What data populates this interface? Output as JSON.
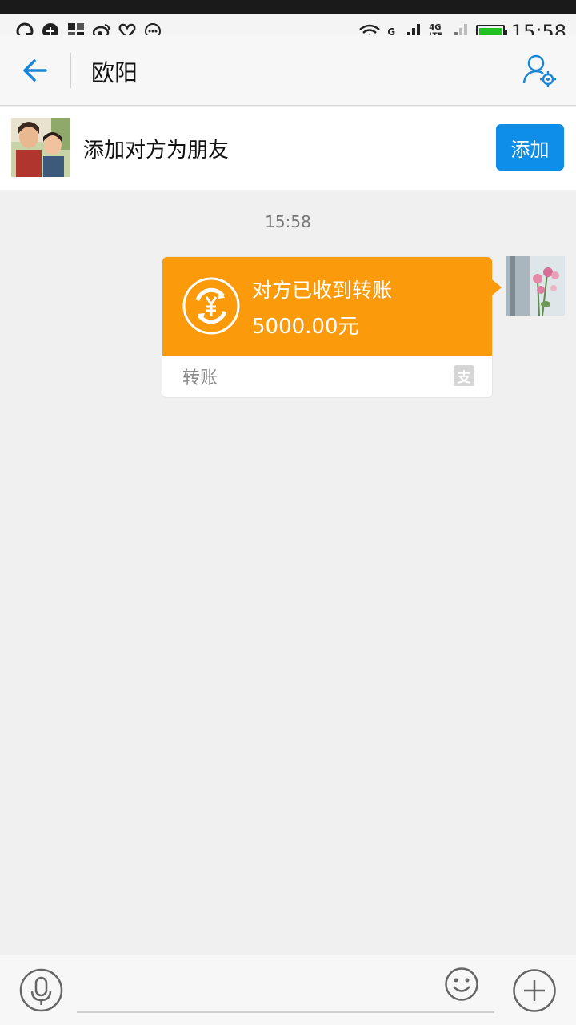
{
  "status_bar": {
    "time": "15:58",
    "network_g": "G",
    "network_4g": "4G",
    "network_lte": "LTE",
    "left_icons": [
      "qq-icon",
      "chat-plus-icon",
      "apps-icon",
      "weibo-icon",
      "heart-icon",
      "more-dots-icon"
    ]
  },
  "header": {
    "title": "欧阳"
  },
  "add_friend_bar": {
    "text": "添加对方为朋友",
    "button_label": "添加"
  },
  "chat": {
    "timestamp": "15:58",
    "messages": [
      {
        "type_label": "转账",
        "status": "对方已收到转账",
        "amount": "5000.00元",
        "badge": "支"
      }
    ]
  },
  "input_bar": {
    "placeholder": ""
  },
  "colors": {
    "accent": "#0e8ee8",
    "transfer_orange": "#fb9a0b",
    "background": "#f0f0f0"
  }
}
